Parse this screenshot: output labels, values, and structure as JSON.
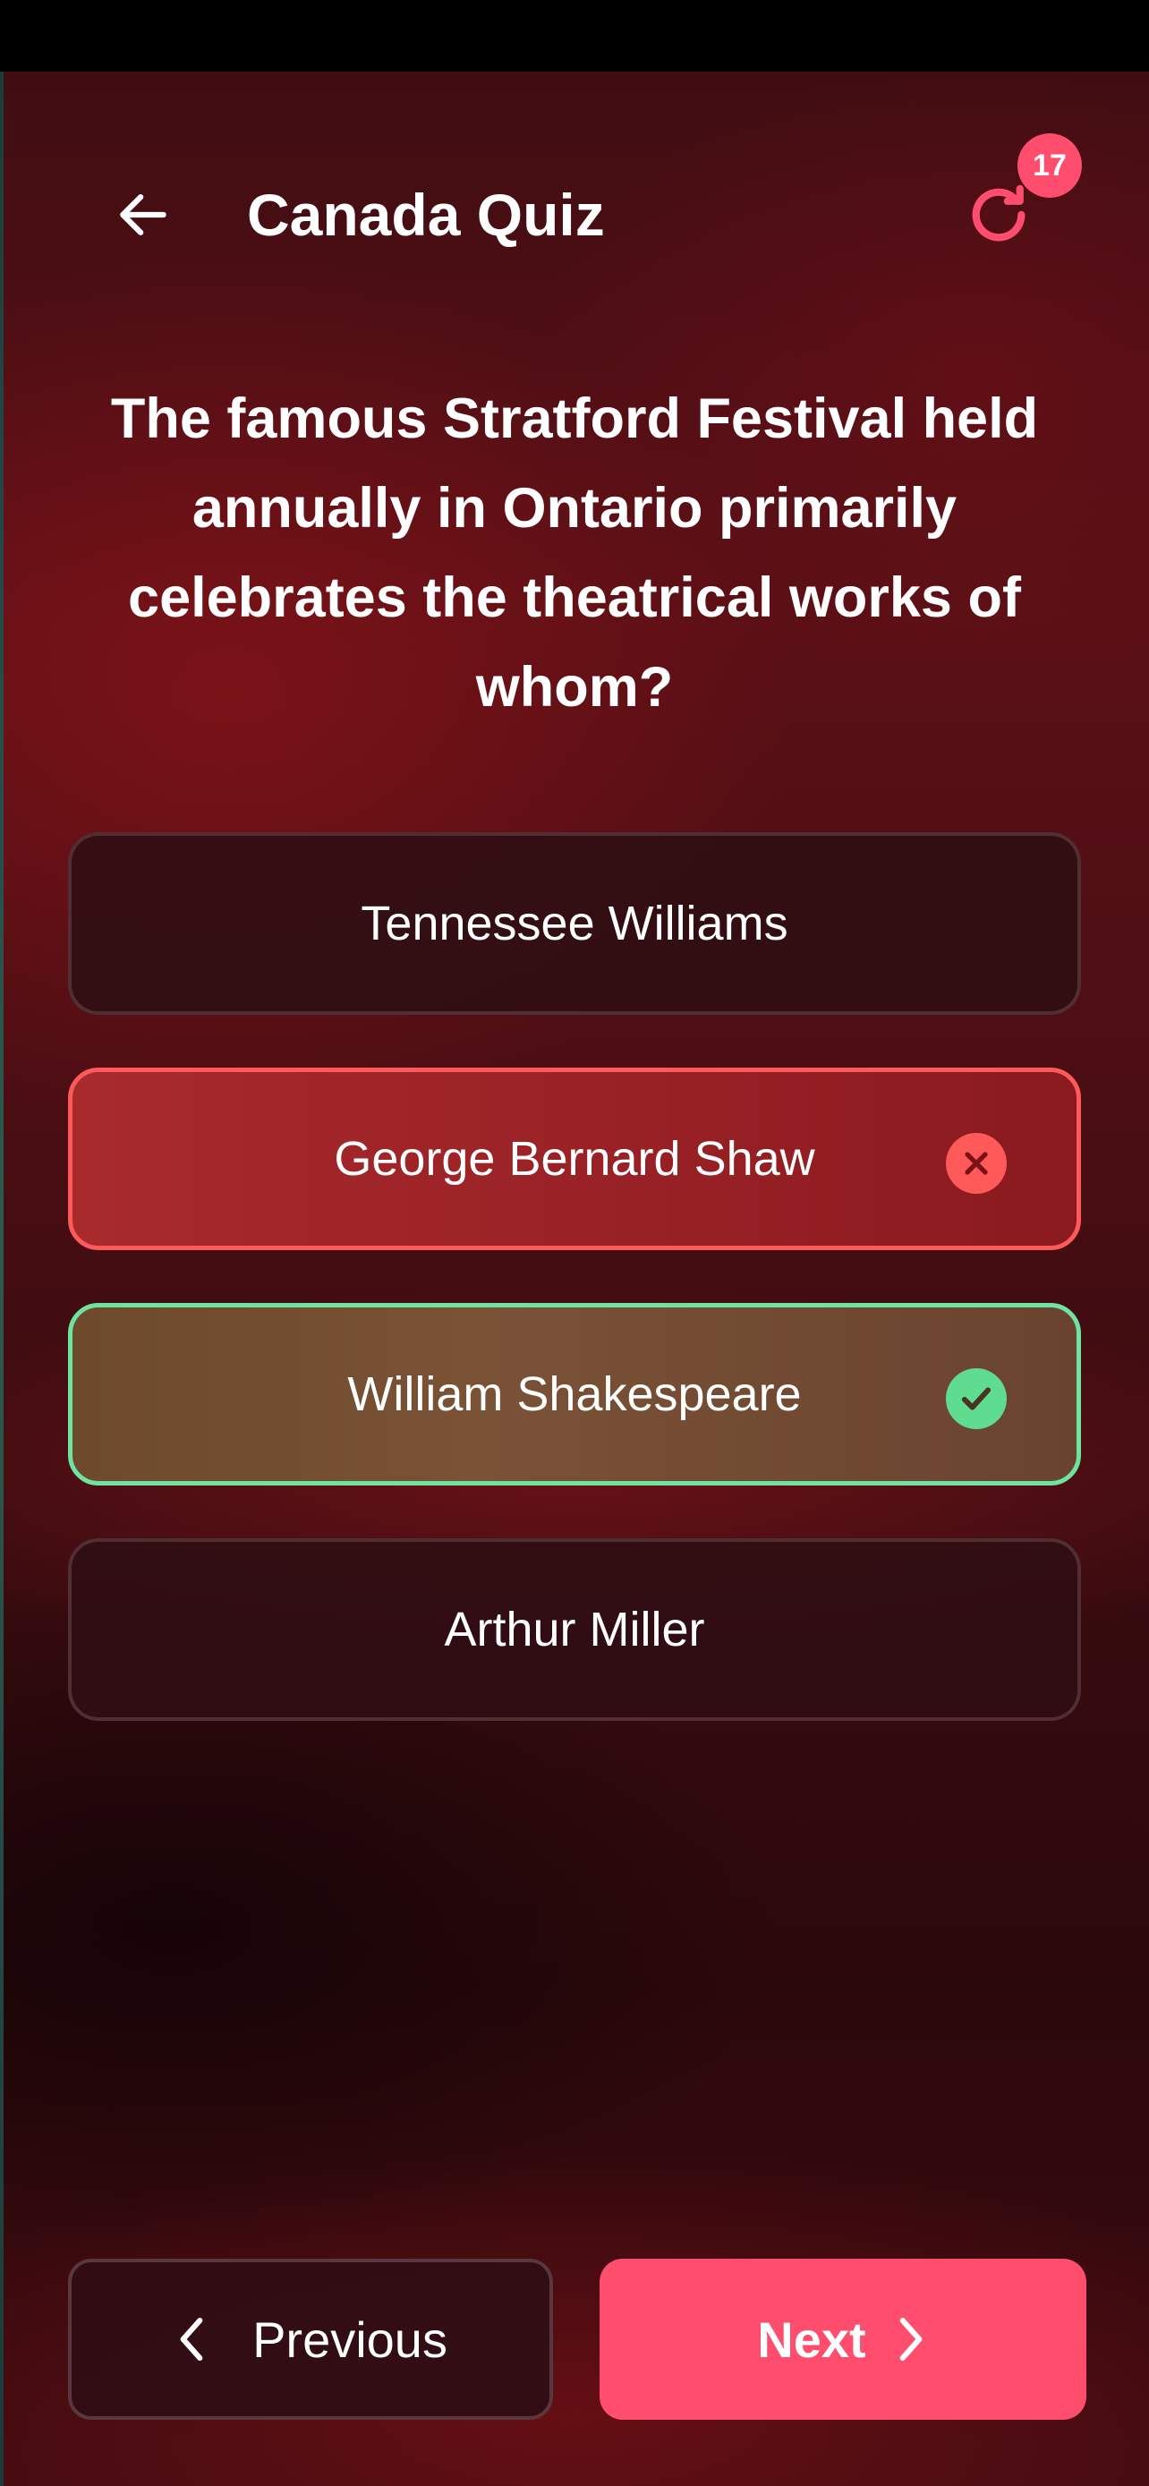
{
  "app": {
    "title": "Canada Quiz",
    "restart_badge_count": "17"
  },
  "question": {
    "text": "The famous Stratford Festival held annually in Ontario primarily celebrates the theatrical works of whom?"
  },
  "options": [
    {
      "label": "Tennessee Williams",
      "state": "neutral"
    },
    {
      "label": "George Bernard Shaw",
      "state": "wrong"
    },
    {
      "label": "William Shakespeare",
      "state": "correct"
    },
    {
      "label": "Arthur Miller",
      "state": "neutral"
    }
  ],
  "navigation": {
    "previous_label": "Previous",
    "next_label": "Next"
  },
  "icons": {
    "back": "arrow-left-icon",
    "restart": "restart-icon",
    "wrong": "close-circle-icon",
    "correct": "check-circle-icon",
    "prev": "chevron-left-icon",
    "next": "chevron-right-icon"
  },
  "colors": {
    "accent": "#ff4d6d",
    "wrong": "#ff5a5a",
    "correct": "#5fdc8f",
    "background": "#4a0e13"
  }
}
